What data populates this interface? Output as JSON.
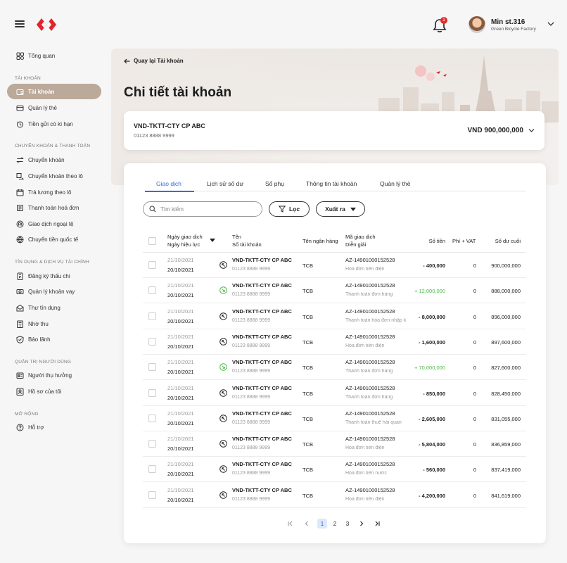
{
  "user": {
    "name": "Min st.316",
    "company": "Green Bicycle Factory",
    "notifications": "1"
  },
  "sidebar": {
    "top": [
      {
        "label": "Tổng quan",
        "icon": "grid-icon"
      }
    ],
    "sections": [
      {
        "title": "TÀI KHOẢN",
        "items": [
          {
            "label": "Tài khoản",
            "icon": "wallet-icon",
            "active": true
          },
          {
            "label": "Quản lý thẻ",
            "icon": "card-icon"
          },
          {
            "label": "Tiền gửi có kì hạn",
            "icon": "deposit-icon"
          }
        ]
      },
      {
        "title": "CHUYỂN KHOẢN & THANH TOÁN",
        "items": [
          {
            "label": "Chuyển khoản",
            "icon": "transfer-icon"
          },
          {
            "label": "Chuyển khoản theo lô",
            "icon": "batch-transfer-icon"
          },
          {
            "label": "Trả lương theo lô",
            "icon": "payroll-icon"
          },
          {
            "label": "Thanh toán hoá đơn",
            "icon": "bill-icon"
          },
          {
            "label": "Giao dịch ngoại tệ",
            "icon": "fx-icon"
          },
          {
            "label": "Chuyển tiền quốc tế",
            "icon": "globe-icon"
          }
        ]
      },
      {
        "title": "TÍN DỤNG & DỊCH VỤ TÀI CHÍNH",
        "items": [
          {
            "label": "Đăng ký thấu chi",
            "icon": "overdraft-icon"
          },
          {
            "label": "Quản lý khoản vay",
            "icon": "loan-icon"
          },
          {
            "label": "Thư tín dụng",
            "icon": "letter-icon"
          },
          {
            "label": "Nhờ thu",
            "icon": "collection-icon"
          },
          {
            "label": "Bảo lãnh",
            "icon": "shield-icon"
          }
        ]
      },
      {
        "title": "QUẢN TRỊ NGƯỜI DÙNG",
        "items": [
          {
            "label": "Người thụ hưởng",
            "icon": "beneficiary-icon"
          },
          {
            "label": "Hồ sơ của tôi",
            "icon": "profile-icon"
          }
        ]
      },
      {
        "title": "MỞ RỘNG",
        "items": [
          {
            "label": "Hỗ trợ",
            "icon": "help-icon"
          }
        ]
      }
    ]
  },
  "header": {
    "back_label": "Quay lại Tài khoản",
    "title": "Chi tiết tài khoản"
  },
  "account": {
    "name": "VND-TKTT-CTY CP ABC",
    "number": "01123 8888 9999",
    "balance": "VND 900,000,000"
  },
  "tabs": [
    {
      "label": "Giao dịch",
      "active": true
    },
    {
      "label": "Lịch sử số dư"
    },
    {
      "label": "Sổ phụ"
    },
    {
      "label": "Thông tin tài khoản"
    },
    {
      "label": "Quản lý thẻ"
    }
  ],
  "toolbar": {
    "search_placeholder": "Tìm kiếm",
    "filter_label": "Lọc",
    "export_label": "Xuất ra"
  },
  "table": {
    "headers": {
      "date_line1": "Ngày giao dịch",
      "date_line2": "Ngày hiệu lực",
      "acc_line1": "Tên",
      "acc_line2": "Số tài khoản",
      "bank": "Tên ngân hàng",
      "code_line1": "Mã giao dịch",
      "code_line2": "Diễn giải",
      "amount": "Số tiền",
      "fee": "Phí + VAT",
      "balance": "Số dư cuối"
    },
    "rows": [
      {
        "d1": "21/10/2021",
        "d2": "20/10/2021",
        "dir": "out",
        "acc": "VND-TKTT-CTY CP ABC",
        "accno": "01123 8888 9999",
        "bank": "TCB",
        "code": "AZ-14901000152528",
        "desc": "Hóa đơn tiền điện",
        "amount": "- 400,000",
        "fee": "0",
        "balance": "900,000,000"
      },
      {
        "d1": "21/10/2021",
        "d2": "20/10/2021",
        "dir": "in",
        "acc": "VND-TKTT-CTY CP ABC",
        "accno": "01123 8888 9999",
        "bank": "TCB",
        "code": "AZ-14901000152528",
        "desc": "Thanh toán đơn hàng",
        "amount": "+ 12,000,000",
        "fee": "0",
        "balance": "888,000,000"
      },
      {
        "d1": "21/10/2021",
        "d2": "20/10/2021",
        "dir": "out",
        "acc": "VND-TKTT-CTY CP ABC",
        "accno": "01123 8888 9999",
        "bank": "TCB",
        "code": "AZ-14901000152528",
        "desc": "Thanh toán hóa đơn nhập k",
        "amount": "- 8,000,000",
        "fee": "0",
        "balance": "896,000,000"
      },
      {
        "d1": "21/10/2021",
        "d2": "20/10/2021",
        "dir": "out",
        "acc": "VND-TKTT-CTY CP ABC",
        "accno": "01123 8888 9999",
        "bank": "TCB",
        "code": "AZ-14901000152528",
        "desc": "Hóa đơn tiền điện",
        "amount": "- 1,600,000",
        "fee": "0",
        "balance": "897,600,000"
      },
      {
        "d1": "21/10/2021",
        "d2": "20/10/2021",
        "dir": "in",
        "acc": "VND-TKTT-CTY CP ABC",
        "accno": "01123 8888 9999",
        "bank": "TCB",
        "code": "AZ-14901000152528",
        "desc": "Thanh toán đơn hàng",
        "amount": "+ 70,000,000",
        "fee": "0",
        "balance": "827,600,000"
      },
      {
        "d1": "21/10/2021",
        "d2": "20/10/2021",
        "dir": "out",
        "acc": "VND-TKTT-CTY CP ABC",
        "accno": "01123 8888 9999",
        "bank": "TCB",
        "code": "AZ-14901000152528",
        "desc": "Thanh toán đơn hàng",
        "amount": "- 850,000",
        "fee": "0",
        "balance": "828,450,000"
      },
      {
        "d1": "21/10/2021",
        "d2": "20/10/2021",
        "dir": "out",
        "acc": "VND-TKTT-CTY CP ABC",
        "accno": "01123 8888 9999",
        "bank": "TCB",
        "code": "AZ-14901000152528",
        "desc": "Thanh toán thuế hải quan",
        "amount": "- 2,605,000",
        "fee": "0",
        "balance": "831,055,000"
      },
      {
        "d1": "21/10/2021",
        "d2": "20/10/2021",
        "dir": "out",
        "acc": "VND-TKTT-CTY CP ABC",
        "accno": "01123 8888 9999",
        "bank": "TCB",
        "code": "AZ-14901000152528",
        "desc": "Hóa đơn tiền điện",
        "amount": "- 5,804,000",
        "fee": "0",
        "balance": "836,859,000"
      },
      {
        "d1": "21/10/2021",
        "d2": "20/10/2021",
        "dir": "out",
        "acc": "VND-TKTT-CTY CP ABC",
        "accno": "01123 8888 9999",
        "bank": "TCB",
        "code": "AZ-14901000152528",
        "desc": "Hóa đơn tiền nước",
        "amount": "- 560,000",
        "fee": "0",
        "balance": "837,419,000"
      },
      {
        "d1": "21/10/2021",
        "d2": "20/10/2021",
        "dir": "out",
        "acc": "VND-TKTT-CTY CP ABC",
        "accno": "01123 8888 9999",
        "bank": "TCB",
        "code": "AZ-14901000152528",
        "desc": "Hóa đơn tiền điện",
        "amount": "- 4,200,000",
        "fee": "0",
        "balance": "841,619,000"
      }
    ]
  },
  "pagination": {
    "pages": [
      "1",
      "2",
      "3"
    ],
    "current": "1"
  },
  "colors": {
    "accent": "#2f6fe0",
    "active_nav": "#bba99a",
    "positive": "#4aba4a",
    "brand_red": "#e0242c"
  }
}
